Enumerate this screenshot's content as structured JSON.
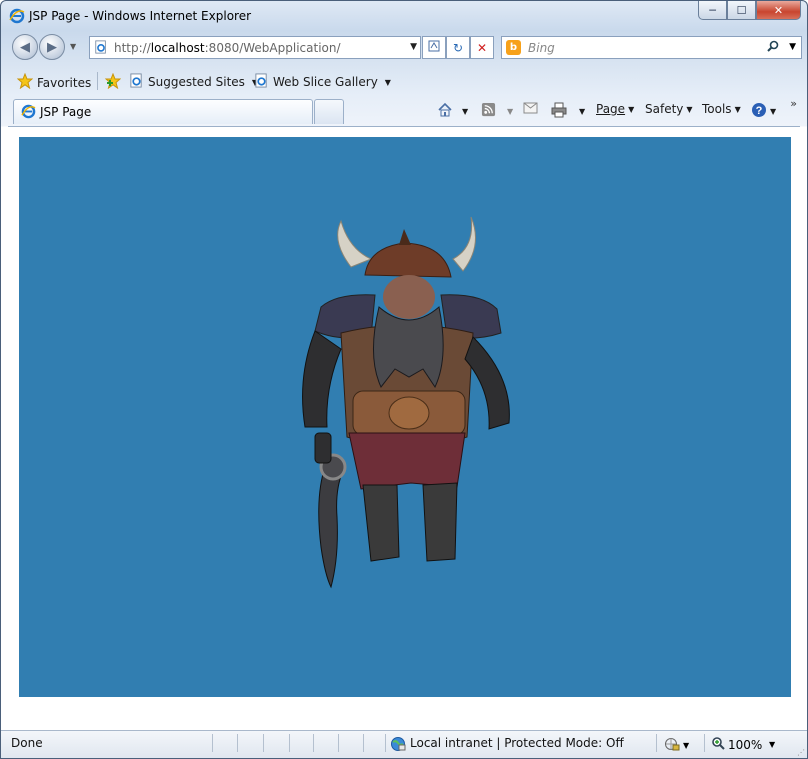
{
  "window": {
    "title": "JSP Page - Windows Internet Explorer",
    "minimize": "─",
    "maximize": "☐",
    "close": "✕"
  },
  "address_bar": {
    "url_prefix": "http://",
    "url_host": "localhost",
    "url_rest": ":8080/WebApplication/",
    "refresh_icon": "↻",
    "stop_icon": "✕"
  },
  "search": {
    "placeholder": "Bing",
    "logo_letter": "b"
  },
  "favorites_bar": {
    "favorites_label": "Favorites",
    "suggested_sites_label": "Suggested Sites",
    "web_slice_label": "Web Slice Gallery"
  },
  "tab": {
    "label": "JSP Page"
  },
  "command_bar": {
    "page_label": "Page",
    "safety_label": "Safety",
    "tools_label": "Tools",
    "more": "»"
  },
  "status_bar": {
    "status_text": "Done",
    "zone_text": "Local intranet | Protected Mode: Off",
    "zoom_text": "100%"
  },
  "colors": {
    "canvas_background": "#317eb1",
    "frame": "#4a5f7a"
  },
  "canvas": {
    "scene": "3D viking dwarf character model with horned helmet holding a sword"
  }
}
